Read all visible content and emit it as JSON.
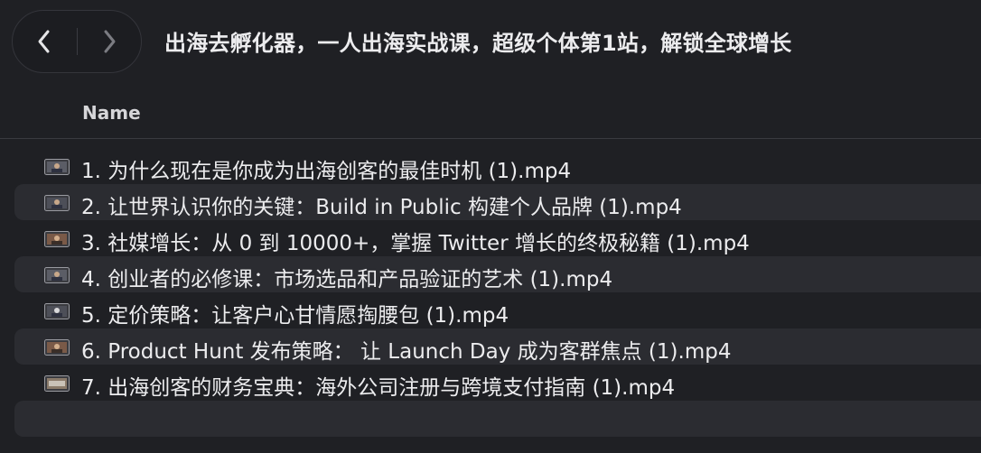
{
  "window": {
    "title": "出海去孵化器，一人出海实战课，超级个体第1站，解锁全球增长"
  },
  "toolbar": {
    "back_icon": "chevron-left-icon",
    "forward_icon": "chevron-right-icon"
  },
  "columns": {
    "name": "Name"
  },
  "files": [
    {
      "name": "1. 为什么现在是你成为出海创客的最佳时机  (1).mp4",
      "icon": "video-file-icon"
    },
    {
      "name": "2. 让世界认识你的关键：Build in Public 构建个人品牌  (1).mp4",
      "icon": "video-file-icon"
    },
    {
      "name": "3. 社媒增长：从 0 到 10000+，掌握 Twitter 增长的终极秘籍  (1).mp4",
      "icon": "video-file-icon"
    },
    {
      "name": "4. 创业者的必修课：市场选品和产品验证的艺术  (1).mp4",
      "icon": "video-file-icon"
    },
    {
      "name": "5. 定价策略：让客户心甘情愿掏腰包  (1).mp4",
      "icon": "video-file-icon"
    },
    {
      "name": "6. Product Hunt 发布策略：  让 Launch Day 成为客群焦点  (1).mp4",
      "icon": "video-file-icon"
    },
    {
      "name": "7. 出海创客的财务宝典：海外公司注册与跨境支付指南  (1).mp4",
      "icon": "video-file-icon"
    }
  ],
  "colors": {
    "background": "#1f2024",
    "stripe": "#2b2c31",
    "text": "#ececee"
  }
}
